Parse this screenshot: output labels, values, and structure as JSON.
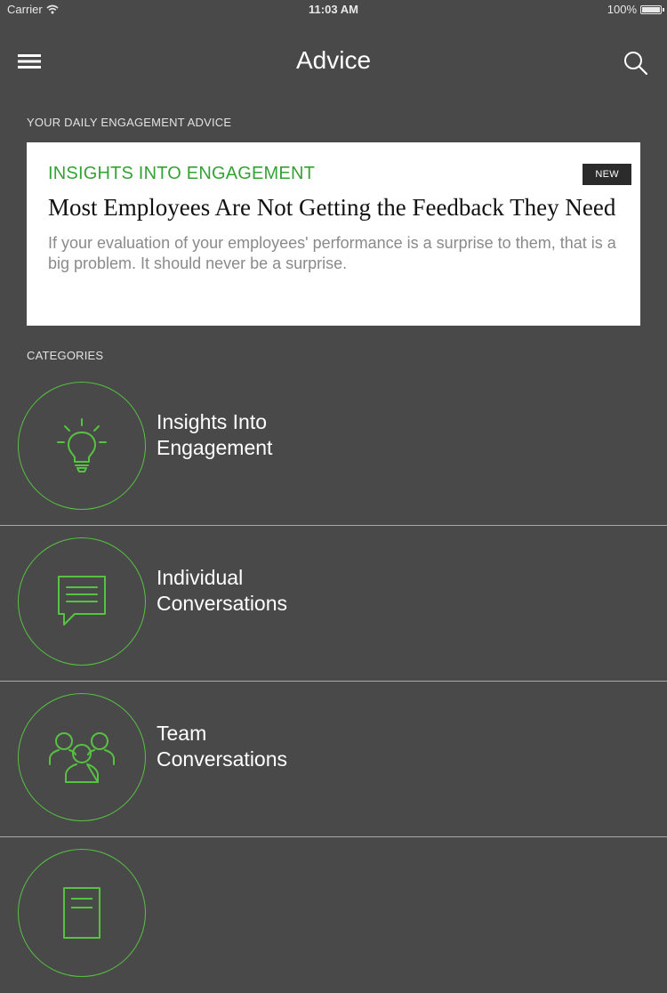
{
  "status_bar": {
    "carrier": "Carrier",
    "time": "11:03 AM",
    "battery": "100%"
  },
  "nav": {
    "title": "Advice",
    "menu_icon": "hamburger-menu-icon",
    "search_icon": "search-icon"
  },
  "daily": {
    "section_label": "YOUR DAILY ENGAGEMENT ADVICE",
    "card": {
      "category": "INSIGHTS INTO ENGAGEMENT",
      "badge": "NEW",
      "title": "Most Employees Are Not Getting the Feedback They Need",
      "body": "If your evaluation of your employees' performance is a surprise to them, that is a big problem. It should never be a surprise."
    }
  },
  "categories": {
    "section_label": "CATEGORIES",
    "items": [
      {
        "label": "Insights Into\nEngagement",
        "icon": "lightbulb-icon"
      },
      {
        "label": "Individual\nConversations",
        "icon": "chat-bubble-icon"
      },
      {
        "label": "Team\nConversations",
        "icon": "team-icon"
      },
      {
        "label": "",
        "icon": "document-icon"
      }
    ]
  },
  "colors": {
    "background": "#4a4949",
    "accent_green": "#55c242",
    "category_green": "#34a334",
    "card_background": "#ffffff",
    "badge_background": "#2b2b2b"
  }
}
